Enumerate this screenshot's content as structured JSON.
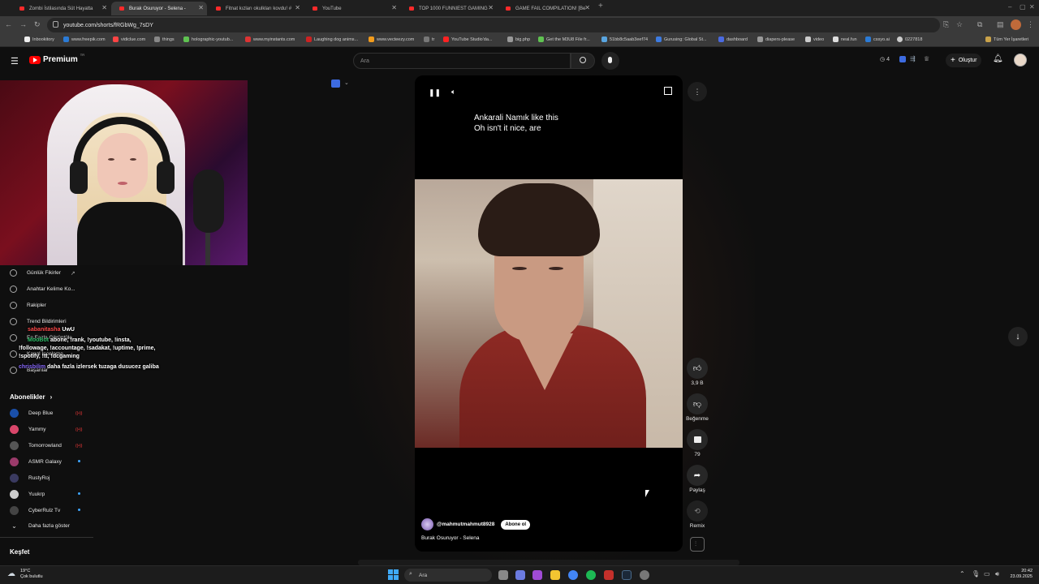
{
  "browser": {
    "tabs": [
      {
        "title": "Zombi İstilasında Süt Hayatta",
        "active": false
      },
      {
        "title": "Burak Osuruyor - Selena -",
        "active": true
      },
      {
        "title": "Fitnat kızları okulkları kovdu! #",
        "active": false
      },
      {
        "title": "YouTube",
        "active": false
      },
      {
        "title": "TOP 1000 FUNNIEST GAMING",
        "active": false
      },
      {
        "title": "GAME FAIL COMPILATION! [Be",
        "active": false
      }
    ],
    "url": "youtube.com/shorts/fRGbWg_7sDY",
    "bookmarks": [
      "Inbookitory",
      "www.freepik.com",
      "vidiclue.com",
      "things",
      "holographic-youtub...",
      "www.myinstants.com",
      "Laughing dog anims...",
      "www.vecteezy.com",
      "tr",
      "YouTube Studio'da...",
      "big.php",
      "Get the M3U8 File fr...",
      "51bb8c5aab3eef74",
      "Gurusing: Global St...",
      "dashboard",
      "diapers-please",
      "video",
      "neal.fun",
      "cssyo.ai",
      "0227818"
    ],
    "bookmark_folder": "Tüm Yer İşaretleri",
    "colors": {
      "accent": "#ff0000",
      "chrome": "#3a3a3a"
    }
  },
  "youtube": {
    "logo_text": "Premium",
    "logo_badge": "TR",
    "search_placeholder": "Ara",
    "notification_count": "4",
    "create_label": "Oluştur"
  },
  "sidebar": {
    "items": [
      {
        "label": "Günlük Fikirler",
        "icon": "external-link-icon"
      },
      {
        "label": "Anahtar Kelime Ko...",
        "icon": "target-icon"
      },
      {
        "label": "Rakipler",
        "icon": "target-icon"
      },
      {
        "label": "Trend Bildirimleri",
        "icon": "target-icon"
      },
      {
        "label": "En Fazla Görüntüle...",
        "icon": "target-icon"
      },
      {
        "label": "Kanal İnceleme",
        "icon": "target-icon"
      },
      {
        "label": "Başarılar",
        "icon": "target-icon"
      }
    ],
    "subs_title": "Abonelikler",
    "subs": [
      {
        "name": "Deep Blue",
        "badge": "live",
        "color": "#1a4fa8"
      },
      {
        "name": "Yammy",
        "badge": "live",
        "color": "#d9466a"
      },
      {
        "name": "Tomorrowland",
        "badge": "live",
        "color": "#555555"
      },
      {
        "name": "ASMR Galaxy",
        "badge": "dot",
        "color": "#9a3a6a"
      },
      {
        "name": "RustyRoj",
        "badge": "",
        "color": "#3a3a60"
      },
      {
        "name": "Yuukrp",
        "badge": "dot",
        "color": "#cccccc"
      },
      {
        "name": "CyberRulz Tv",
        "badge": "dot",
        "color": "#444444"
      }
    ],
    "show_more": "Daha fazla göster",
    "explore": "Keşfet"
  },
  "chat": [
    {
      "user": "sabanitasha",
      "msg": "UwU"
    },
    {
      "user": "MooBot",
      "msg": "abone, !rank, !youtube, !insta,"
    },
    {
      "user": "",
      "msg": "!followage, !accountage, !sadakat, !uptime, !prime,"
    },
    {
      "user": "",
      "msg": "!spotify, !tt, !dcgaming"
    },
    {
      "user": "chrisbilim",
      "msg": "daha fazla izlersek tuzaga dusucez galiba"
    }
  ],
  "short": {
    "subtitle_line1": "Ankarali Namık like this",
    "subtitle_line2": "Oh isn't it nice, are",
    "channel": "@mahmutmahmut8928",
    "subscribe_label": "Abone ol",
    "title": "Burak Osuruyor - Selena",
    "likes": "3,9 B",
    "dislike_label": "Beğenme",
    "comments": "79",
    "share_label": "Paylaş",
    "remix_label": "Remix"
  },
  "taskbar": {
    "weather_temp": "19°C",
    "weather_desc": "Çok bulutlu",
    "search_placeholder": "Ara",
    "time": "20:42",
    "date": "23.09.2025"
  }
}
